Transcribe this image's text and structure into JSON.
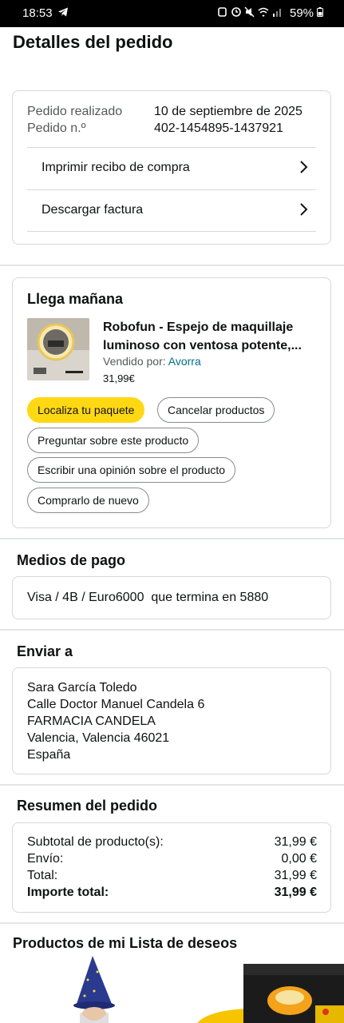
{
  "status_bar": {
    "time": "18:53",
    "battery": "59%"
  },
  "page": {
    "title": "Detalles del pedido"
  },
  "order_info": {
    "placed_label": "Pedido realizado",
    "placed_value": "10 de septiembre de 2025",
    "number_label": "Pedido n.º",
    "number_value": "402-1454895-1437921",
    "links": [
      {
        "label": "Imprimir recibo de compra"
      },
      {
        "label": "Descargar factura"
      }
    ]
  },
  "shipment": {
    "heading": "Llega mañana",
    "product_title": "Robofun - Espejo de maquillaje luminoso con ventosa potente,...",
    "sold_by_label": "Vendido por:",
    "seller": "Avorra",
    "price": "31,99€",
    "actions": {
      "locate": "Localiza tu paquete",
      "cancel": "Cancelar productos",
      "ask": "Preguntar sobre este producto",
      "review": "Escribir una opinión sobre el producto",
      "rebuy": "Comprarlo de nuevo"
    }
  },
  "payment": {
    "heading": "Medios de pago",
    "method": "Visa / 4B / Euro6000  que termina en 5880"
  },
  "shipping": {
    "heading": "Enviar a",
    "lines": [
      "Sara García Toledo",
      "Calle Doctor Manuel Candela 6",
      "FARMACIA CANDELA",
      "Valencia, Valencia 46021",
      "España"
    ]
  },
  "summary": {
    "heading": "Resumen del pedido",
    "rows": [
      {
        "label": "Subtotal de producto(s):",
        "value": "31,99 €"
      },
      {
        "label": "Envío:",
        "value": "0,00 €"
      },
      {
        "label": "Total:",
        "value": "31,99 €"
      },
      {
        "label": "Importe total:",
        "value": "31,99 €"
      }
    ]
  },
  "wishlist": {
    "heading": "Productos de mi Lista de deseos"
  }
}
